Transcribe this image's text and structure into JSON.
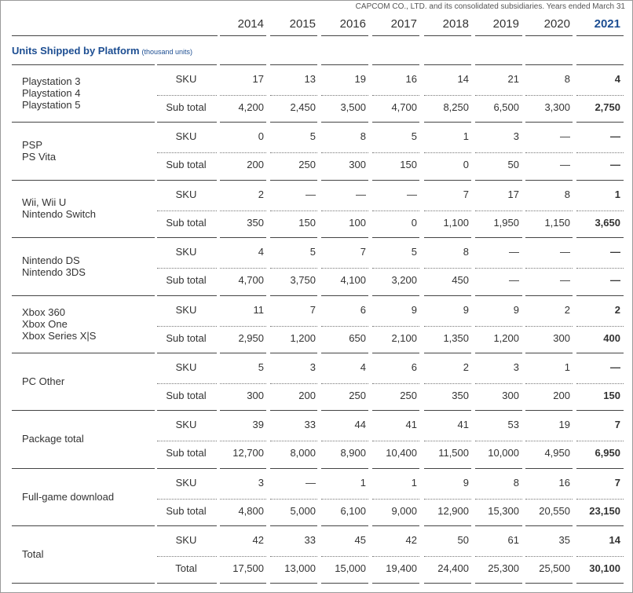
{
  "source_note": "CAPCOM CO., LTD. and its consolidated subsidiaries. Years ended March 31",
  "years": [
    "2014",
    "2015",
    "2016",
    "2017",
    "2018",
    "2019",
    "2020",
    "2021"
  ],
  "section_title": "Units Shipped by Platform",
  "section_unit": "(thousand units)",
  "groups": [
    {
      "platform": [
        "Playstation 3",
        "Playstation 4",
        "Playstation 5"
      ],
      "rows": [
        {
          "label": "SKU",
          "values": [
            "17",
            "13",
            "19",
            "16",
            "14",
            "21",
            "8",
            "4"
          ]
        },
        {
          "label": "Sub total",
          "values": [
            "4,200",
            "2,450",
            "3,500",
            "4,700",
            "8,250",
            "6,500",
            "3,300",
            "2,750"
          ]
        }
      ]
    },
    {
      "platform": [
        "PSP",
        "PS Vita"
      ],
      "rows": [
        {
          "label": "SKU",
          "values": [
            "0",
            "5",
            "8",
            "5",
            "1",
            "3",
            "—",
            "—"
          ]
        },
        {
          "label": "Sub total",
          "values": [
            "200",
            "250",
            "300",
            "150",
            "0",
            "50",
            "—",
            "—"
          ]
        }
      ]
    },
    {
      "platform": [
        "Wii, Wii U",
        "Nintendo Switch"
      ],
      "rows": [
        {
          "label": "SKU",
          "values": [
            "2",
            "—",
            "—",
            "—",
            "7",
            "17",
            "8",
            "1"
          ]
        },
        {
          "label": "Sub total",
          "values": [
            "350",
            "150",
            "100",
            "0",
            "1,100",
            "1,950",
            "1,150",
            "3,650"
          ]
        }
      ]
    },
    {
      "platform": [
        "Nintendo DS",
        "Nintendo 3DS"
      ],
      "rows": [
        {
          "label": "SKU",
          "values": [
            "4",
            "5",
            "7",
            "5",
            "8",
            "—",
            "—",
            "—"
          ]
        },
        {
          "label": "Sub total",
          "values": [
            "4,700",
            "3,750",
            "4,100",
            "3,200",
            "450",
            "—",
            "—",
            "—"
          ]
        }
      ]
    },
    {
      "platform": [
        "Xbox 360",
        "Xbox One",
        "Xbox Series X|S"
      ],
      "rows": [
        {
          "label": "SKU",
          "values": [
            "11",
            "7",
            "6",
            "9",
            "9",
            "9",
            "2",
            "2"
          ]
        },
        {
          "label": "Sub total",
          "values": [
            "2,950",
            "1,200",
            "650",
            "2,100",
            "1,350",
            "1,200",
            "300",
            "400"
          ]
        }
      ]
    },
    {
      "platform": [
        "PC Other"
      ],
      "rows": [
        {
          "label": "SKU",
          "values": [
            "5",
            "3",
            "4",
            "6",
            "2",
            "3",
            "1",
            "—"
          ]
        },
        {
          "label": "Sub total",
          "values": [
            "300",
            "200",
            "250",
            "250",
            "350",
            "300",
            "200",
            "150"
          ]
        }
      ]
    },
    {
      "platform": [
        "Package total"
      ],
      "rows": [
        {
          "label": "SKU",
          "values": [
            "39",
            "33",
            "44",
            "41",
            "41",
            "53",
            "19",
            "7"
          ]
        },
        {
          "label": "Sub total",
          "values": [
            "12,700",
            "8,000",
            "8,900",
            "10,400",
            "11,500",
            "10,000",
            "4,950",
            "6,950"
          ]
        }
      ]
    },
    {
      "platform": [
        "Full-game download"
      ],
      "rows": [
        {
          "label": "SKU",
          "values": [
            "3",
            "—",
            "1",
            "1",
            "9",
            "8",
            "16",
            "7"
          ]
        },
        {
          "label": "Sub total",
          "values": [
            "4,800",
            "5,000",
            "6,100",
            "9,000",
            "12,900",
            "15,300",
            "20,550",
            "23,150"
          ]
        }
      ]
    },
    {
      "platform": [
        "Total"
      ],
      "rows": [
        {
          "label": "SKU",
          "values": [
            "42",
            "33",
            "45",
            "42",
            "50",
            "61",
            "35",
            "14"
          ]
        },
        {
          "label": "Total",
          "values": [
            "17,500",
            "13,000",
            "15,000",
            "19,400",
            "24,400",
            "25,300",
            "25,500",
            "30,100"
          ]
        }
      ]
    }
  ]
}
